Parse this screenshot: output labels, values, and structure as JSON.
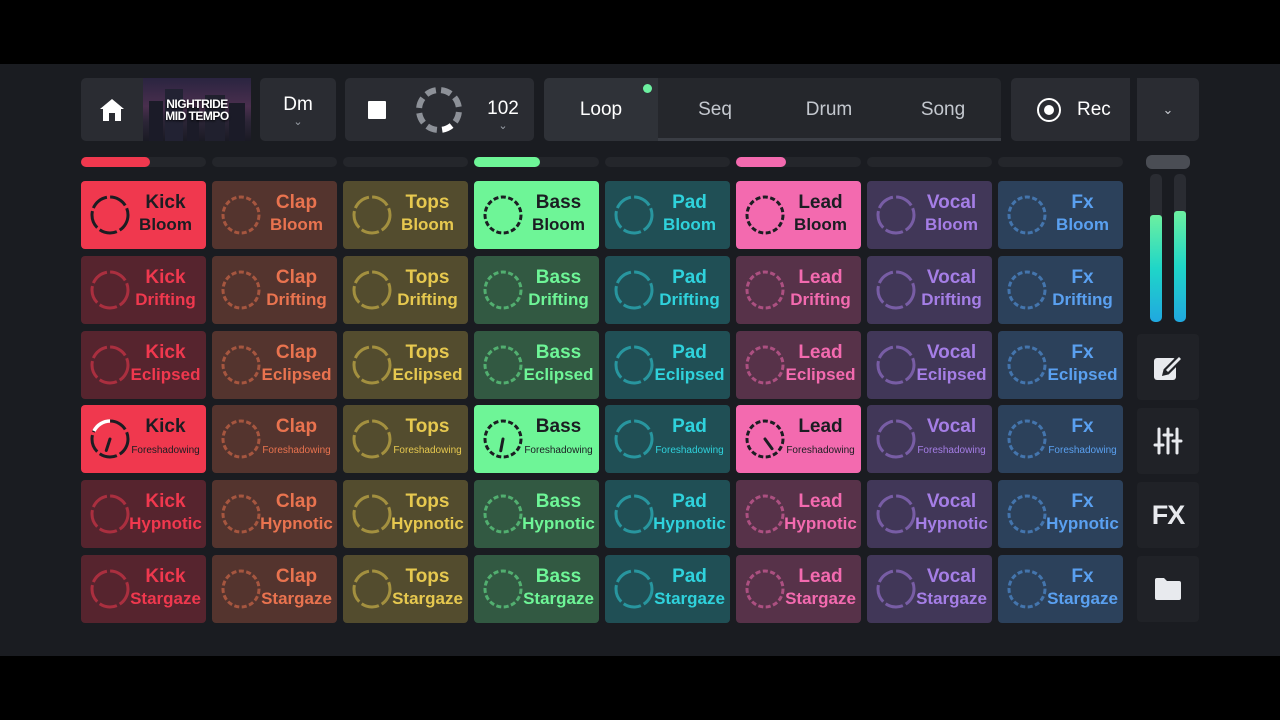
{
  "header": {
    "project_title_line1": "NIGHTRIDE",
    "project_title_line2": "MID TEMPO",
    "key": "Dm",
    "tempo": "102",
    "tabs": [
      "Loop",
      "Seq",
      "Drum",
      "Song"
    ],
    "active_tab": "Loop",
    "rec_label": "Rec"
  },
  "tracks": [
    {
      "name": "Kick",
      "accent": "#f0384e",
      "active_row": 3,
      "progress": 0.55
    },
    {
      "name": "Clap",
      "accent": "#e9734f",
      "active_row": null,
      "progress": 0
    },
    {
      "name": "Tops",
      "accent": "#e6c84f",
      "active_row": null,
      "progress": 0
    },
    {
      "name": "Bass",
      "accent": "#6ef597",
      "active_row": 3,
      "progress": 0.53
    },
    {
      "name": "Pad",
      "accent": "#2fd2dc",
      "active_row": null,
      "progress": 0
    },
    {
      "name": "Lead",
      "accent": "#f36aaf",
      "active_row": 3,
      "progress": 0.4
    },
    {
      "name": "Vocal",
      "accent": "#a57ee6",
      "active_row": null,
      "progress": 0
    },
    {
      "name": "Fx",
      "accent": "#5aa0f0",
      "active_row": null,
      "progress": 0
    }
  ],
  "scenes": [
    "Bloom",
    "Drifting",
    "Eclipsed",
    "Foreshadowing",
    "Hypnotic",
    "Stargaze"
  ],
  "highlighted_cells": [
    [
      0,
      0
    ],
    [
      3,
      0
    ],
    [
      5,
      0
    ],
    [
      0,
      3
    ],
    [
      3,
      3
    ],
    [
      5,
      3
    ]
  ],
  "master_levels": [
    0.72,
    0.75
  ],
  "side_buttons": [
    {
      "icon": "edit-icon"
    },
    {
      "icon": "mixer-icon"
    },
    {
      "label": "FX"
    },
    {
      "icon": "folder-icon"
    }
  ]
}
